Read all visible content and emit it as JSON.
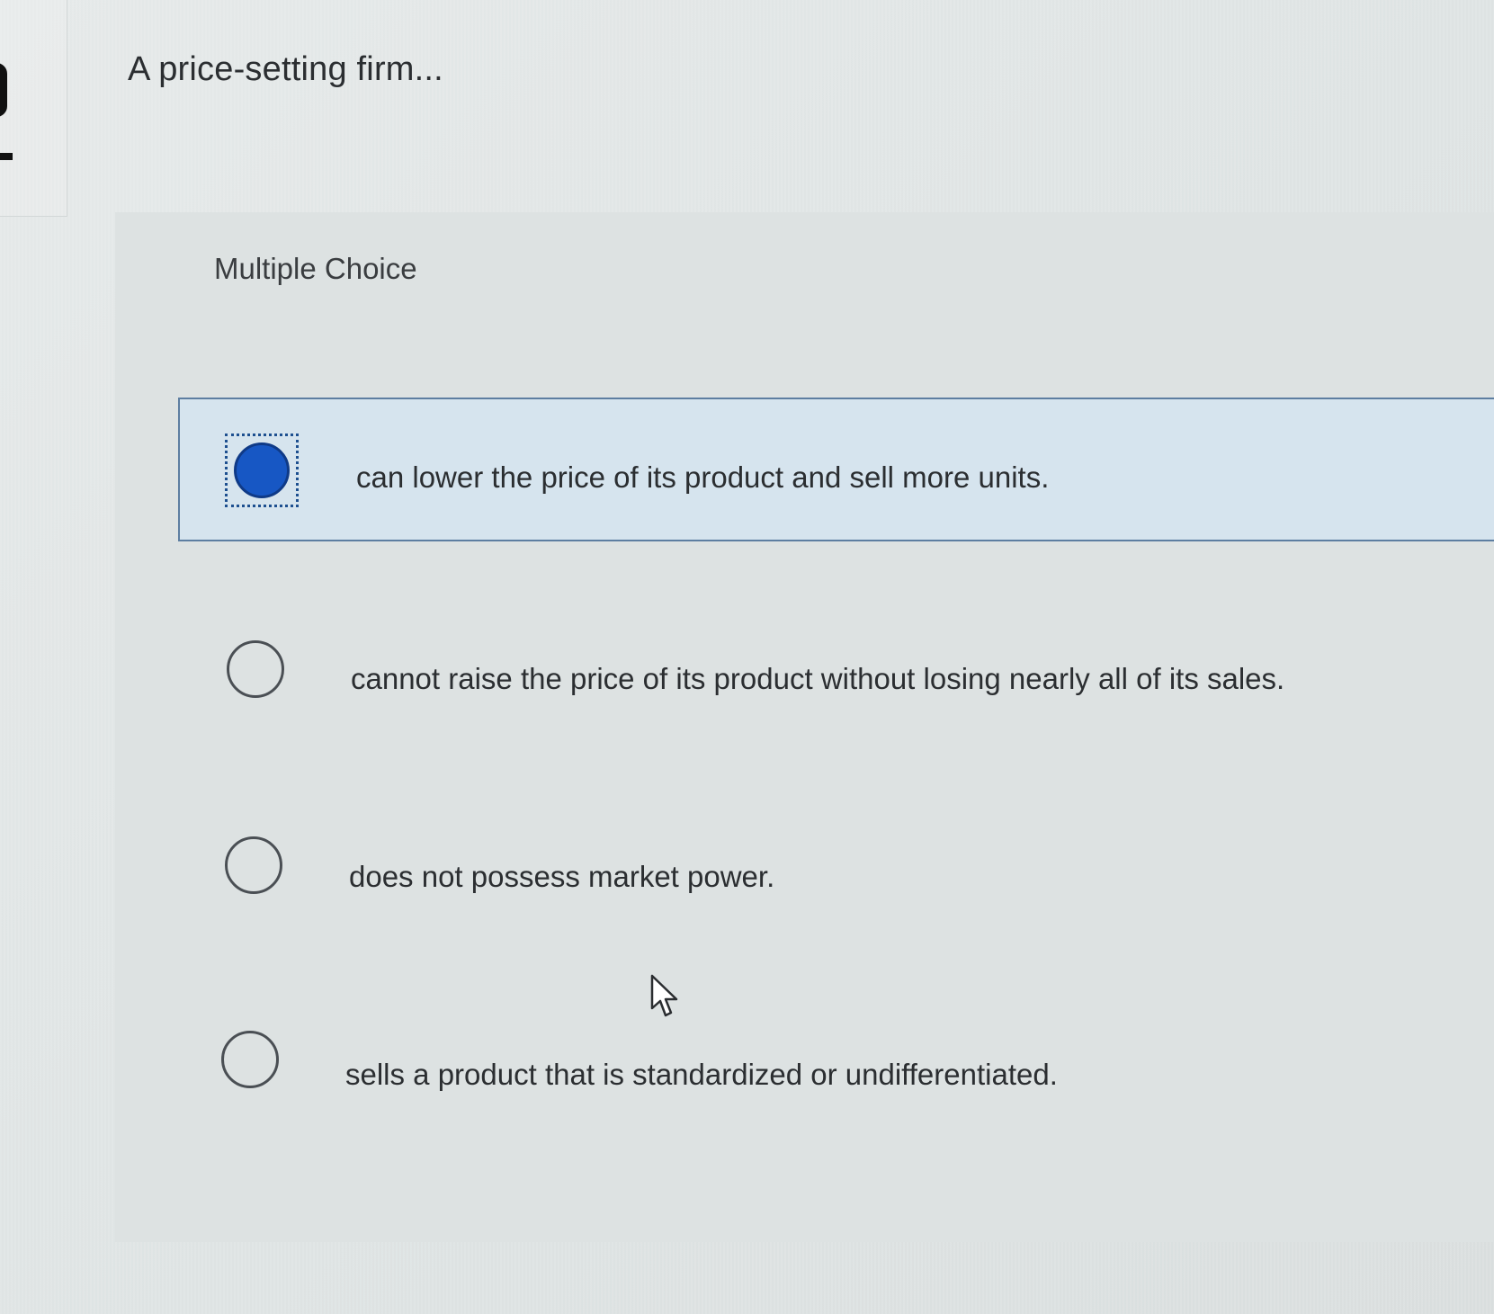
{
  "question": {
    "prompt": "A price-setting firm..."
  },
  "question_type": "Multiple Choice",
  "choices": [
    {
      "label": "can lower the price of its product and sell more units.",
      "selected": true
    },
    {
      "label": "cannot raise the price of its product without losing nearly all of its sales.",
      "selected": false
    },
    {
      "label": "does not possess market power.",
      "selected": false
    },
    {
      "label": "sells a product that is standardized or undifferentiated.",
      "selected": false
    }
  ],
  "colors": {
    "selected_radio": "#1757c4",
    "selected_row_background": "#d6e4ee",
    "selected_row_border": "#5d7ea1"
  },
  "icons": {
    "cursor": "mouse-pointer-icon"
  }
}
